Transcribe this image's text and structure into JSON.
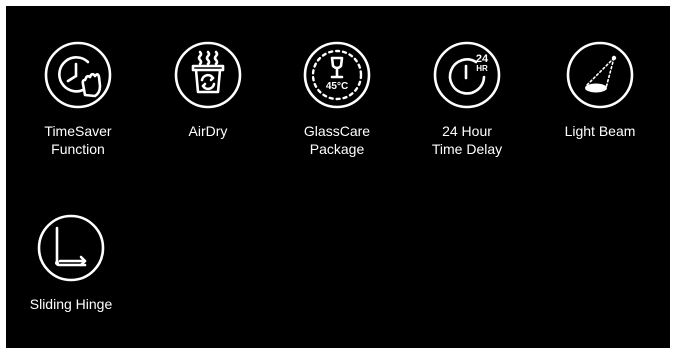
{
  "features": [
    {
      "icon": "clock-hand-icon",
      "label": "TimeSaver\nFunction"
    },
    {
      "icon": "airdry-basket-icon",
      "label": "AirDry"
    },
    {
      "icon": "wine-glass-45c-icon",
      "label": "GlassCare\nPackage",
      "icon_text": "45°C"
    },
    {
      "icon": "clock-24hr-icon",
      "label": "24 Hour\nTime Delay",
      "icon_text_top": "24",
      "icon_text_bottom": "HR"
    },
    {
      "icon": "light-beam-icon",
      "label": "Light Beam"
    },
    {
      "icon": "sliding-hinge-icon",
      "label": "Sliding Hinge"
    }
  ],
  "colors": {
    "background": "#000000",
    "foreground": "#ffffff"
  }
}
